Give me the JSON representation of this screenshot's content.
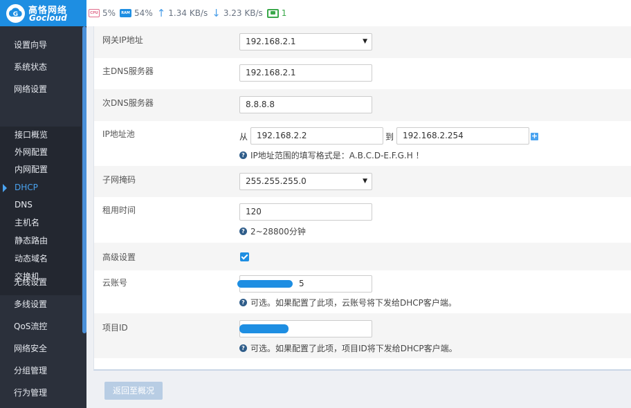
{
  "brand": {
    "name_cn": "高恪网络",
    "name_en": "Gocloud"
  },
  "status": {
    "cpu_icon": "CPU",
    "cpu": "5%",
    "ram_icon": "RAM",
    "ram": "54%",
    "upload": "1.34 KB/s",
    "download": "3.23 KB/s",
    "online_users": "1"
  },
  "sidebar": {
    "items": [
      "设置向导",
      "系统状态",
      "网络设置"
    ],
    "sub_items": [
      "接口概览",
      "外网配置",
      "内网配置",
      "DHCP",
      "DNS",
      "主机名",
      "静态路由",
      "动态域名",
      "交换机"
    ],
    "active_sub": "DHCP",
    "bottom_items": [
      "无线设置",
      "多线设置",
      "QoS流控",
      "网络安全",
      "分组管理",
      "行为管理"
    ]
  },
  "form": {
    "gateway": {
      "label": "网关IP地址",
      "value": "192.168.2.1"
    },
    "dns1": {
      "label": "主DNS服务器",
      "value": "192.168.2.1"
    },
    "dns2": {
      "label": "次DNS服务器",
      "value": "8.8.8.8"
    },
    "pool": {
      "label": "IP地址池",
      "from_label": "从",
      "from": "192.168.2.2",
      "to_label": "到",
      "to": "192.168.2.254",
      "hint": "IP地址范围的填写格式是：A.B.C.D-E.F.G.H ！"
    },
    "netmask": {
      "label": "子网掩码",
      "value": "255.255.255.0"
    },
    "lease": {
      "label": "租用时间",
      "value": "120",
      "hint": "2~28800分钟"
    },
    "advanced": {
      "label": "高级设置",
      "checked": true
    },
    "cloud_account": {
      "label": "云账号",
      "value_visible": "5",
      "hint": "可选。如果配置了此项，云账号将下发给DHCP客户端。"
    },
    "project_id": {
      "label": "项目ID",
      "hint": "可选。如果配置了此项，项目ID将下发给DHCP客户端。"
    }
  },
  "actions": {
    "back": "返回至概况"
  },
  "colors": {
    "brand_blue": "#1e8ee2",
    "sidebar_bg": "#2b303b",
    "active": "#4aa3f0"
  }
}
